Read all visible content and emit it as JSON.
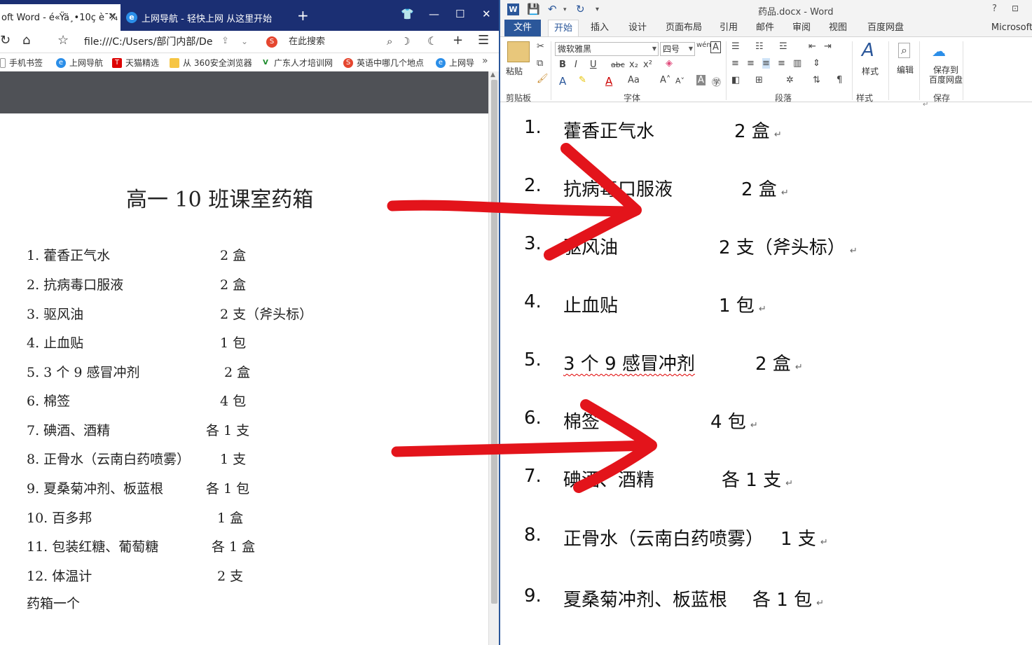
{
  "browser": {
    "tabs": [
      {
        "label": "oft Word - é«Ÿä¸•10ç­ è¯¾"
      },
      {
        "label": "上网导航 - 轻快上网 从这里开始"
      }
    ],
    "address": "file:///C:/Users/部门内部/De",
    "search_placeholder": "在此搜索",
    "bookmarks": [
      {
        "label": "手机书签",
        "icon": "phone-icon"
      },
      {
        "label": "上网导航",
        "icon": "ie-icon"
      },
      {
        "label": "天猫精选",
        "icon": "tmall-icon"
      },
      {
        "label": "从 360安全浏览器",
        "icon": "folder-icon"
      },
      {
        "label": "广东人才培训网",
        "icon": "v-icon"
      },
      {
        "label": "英语中哪几个地点",
        "icon": "sogou-icon"
      },
      {
        "label": "上网导",
        "icon": "ie-icon"
      }
    ],
    "doc": {
      "title": "高一 10 班课室药箱",
      "items": [
        {
          "name": "1. 藿香正气水",
          "qty": "2 盒"
        },
        {
          "name": "2. 抗病毒口服液",
          "qty": "2 盒"
        },
        {
          "name": "3. 驱风油",
          "qty": "2 支（斧头标）"
        },
        {
          "name": "4. 止血贴",
          "qty": "1 包"
        },
        {
          "name": "5. 3 个 9 感冒冲剂",
          "qty": "2 盒"
        },
        {
          "name": "6. 棉签",
          "qty": "4 包"
        },
        {
          "name": "7. 碘酒、酒精",
          "qty": "各 1 支"
        },
        {
          "name": "8. 正骨水（云南白药喷雾）",
          "qty": "1 支"
        },
        {
          "name": "9. 夏桑菊冲剂、板蓝根",
          "qty": "各 1 包"
        },
        {
          "name": "10. 百多邦",
          "qty": "1 盒"
        },
        {
          "name": "11. 包装红糖、葡萄糖",
          "qty": "各 1 盒"
        },
        {
          "name": "12. 体温计",
          "qty": "2 支"
        }
      ],
      "footer": "药箱一个"
    }
  },
  "word": {
    "doc_name": "药品.docx - Word",
    "account": "Microsoft",
    "ribbon_tabs": [
      "文件",
      "开始",
      "插入",
      "设计",
      "页面布局",
      "引用",
      "邮件",
      "审阅",
      "视图",
      "百度网盘"
    ],
    "font_name": "微软雅黑",
    "font_size": "四号",
    "groups": {
      "clipboard": "剪贴板",
      "font": "字体",
      "paragraph": "段落",
      "styles": "样式",
      "save": "保存"
    },
    "buttons": {
      "paste": "粘贴",
      "styles": "样式",
      "edit": "编辑",
      "save_to_baidu_line1": "保存到",
      "save_to_baidu_line2": "百度网盘"
    },
    "items": [
      {
        "num": "1.",
        "name": "藿香正气水",
        "qty": "2 盒"
      },
      {
        "num": "2.",
        "name": "抗病毒口服液",
        "qty": "2 盒"
      },
      {
        "num": "3.",
        "name": "驱风油",
        "qty": "2 支（斧头标）"
      },
      {
        "num": "4.",
        "name": "止血贴",
        "qty": "1 包"
      },
      {
        "num": "5.",
        "name": "3 个 9 感冒冲剂",
        "qty": "2 盒"
      },
      {
        "num": "6.",
        "name": "棉签",
        "qty": "4 包"
      },
      {
        "num": "7.",
        "name": "碘酒、酒精",
        "qty": "各 1 支"
      },
      {
        "num": "8.",
        "name": "正骨水（云南白药喷雾）",
        "qty": "1 支"
      },
      {
        "num": "9.",
        "name": "夏桑菊冲剂、板蓝根",
        "qty": "各 1 包"
      }
    ],
    "paragraph_mark": "↵"
  },
  "colors": {
    "browser_tabbar": "#1b2f73",
    "word_blue": "#2b579a",
    "annotation_red": "#e3141b"
  }
}
